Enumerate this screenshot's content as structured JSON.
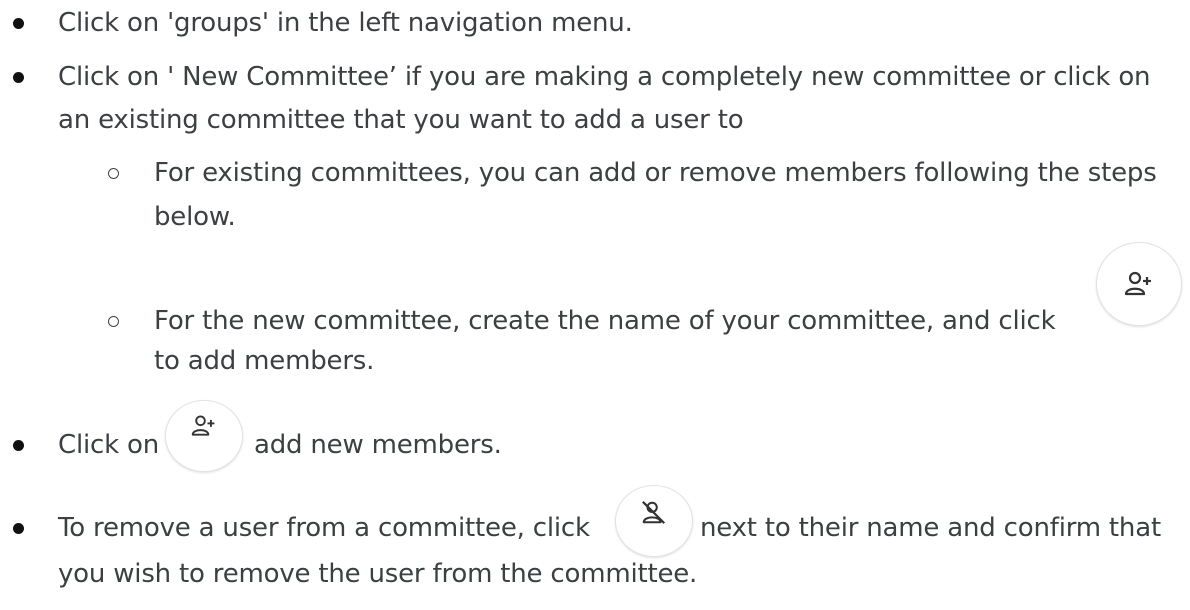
{
  "instructions": {
    "step1": "Click on 'groups' in the left navigation menu.",
    "step2_line1": "Click on ' New Committee’ if you are making a completely new committee or click on",
    "step2_line2": "an existing committee that you want to add a user to",
    "sub1_line1": "For existing committees, you can add or remove members following the steps",
    "sub1_line2": "below.",
    "sub2_line1": "For the new committee, create the name of your committee, and click",
    "sub2_line2": "to add members.",
    "step3_before": "Click on",
    "step3_after": "add new members.",
    "step4_line1_before": "To remove a user from a committee, click",
    "step4_line1_after": "next to their name and confirm that",
    "step4_line2": "you wish to remove the user from the committee."
  },
  "icons": {
    "add_member": "add-member-icon",
    "remove_member": "remove-member-icon"
  }
}
